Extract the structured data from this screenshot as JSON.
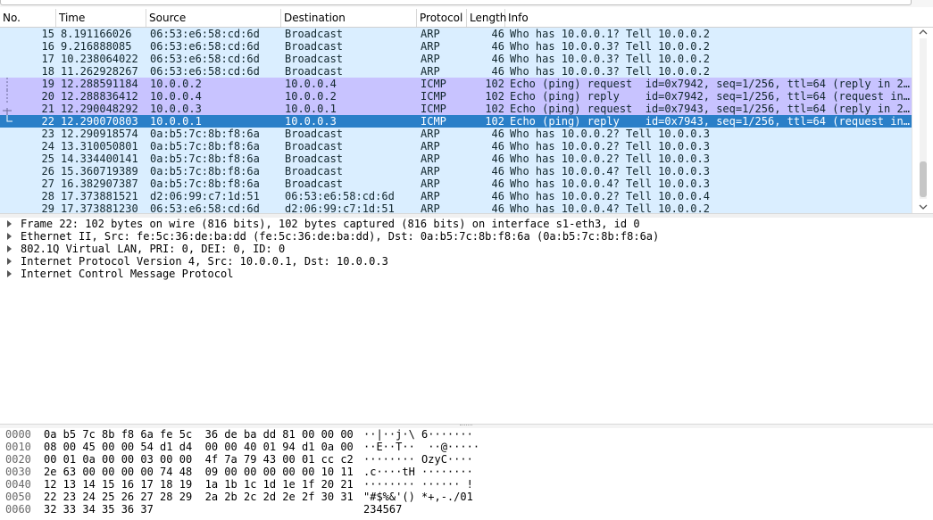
{
  "columns": {
    "no": "No.",
    "time": "Time",
    "source": "Source",
    "destination": "Destination",
    "protocol": "Protocol",
    "length": "Length",
    "info": "Info"
  },
  "packets": [
    {
      "no": "15",
      "time": "8.191166026",
      "src": "06:53:e6:58:cd:6d",
      "dst": "Broadcast",
      "proto": "ARP",
      "len": "46",
      "info": "Who has 10.0.0.1? Tell 10.0.0.2"
    },
    {
      "no": "16",
      "time": "9.216888085",
      "src": "06:53:e6:58:cd:6d",
      "dst": "Broadcast",
      "proto": "ARP",
      "len": "46",
      "info": "Who has 10.0.0.3? Tell 10.0.0.2"
    },
    {
      "no": "17",
      "time": "10.238064022",
      "src": "06:53:e6:58:cd:6d",
      "dst": "Broadcast",
      "proto": "ARP",
      "len": "46",
      "info": "Who has 10.0.0.3? Tell 10.0.0.2"
    },
    {
      "no": "18",
      "time": "11.262928267",
      "src": "06:53:e6:58:cd:6d",
      "dst": "Broadcast",
      "proto": "ARP",
      "len": "46",
      "info": "Who has 10.0.0.3? Tell 10.0.0.2"
    },
    {
      "no": "19",
      "time": "12.288591184",
      "src": "10.0.0.2",
      "dst": "10.0.0.4",
      "proto": "ICMP",
      "len": "102",
      "info": "Echo (ping) request  id=0x7942, seq=1/256, ttl=64 (reply in 2…"
    },
    {
      "no": "20",
      "time": "12.288836412",
      "src": "10.0.0.4",
      "dst": "10.0.0.2",
      "proto": "ICMP",
      "len": "102",
      "info": "Echo (ping) reply    id=0x7942, seq=1/256, ttl=64 (request in…"
    },
    {
      "no": "21",
      "time": "12.290048292",
      "src": "10.0.0.3",
      "dst": "10.0.0.1",
      "proto": "ICMP",
      "len": "102",
      "info": "Echo (ping) request  id=0x7943, seq=1/256, ttl=64 (reply in 2…"
    },
    {
      "no": "22",
      "time": "12.290070803",
      "src": "10.0.0.1",
      "dst": "10.0.0.3",
      "proto": "ICMP",
      "len": "102",
      "info": "Echo (ping) reply    id=0x7943, seq=1/256, ttl=64 (request in…"
    },
    {
      "no": "23",
      "time": "12.290918574",
      "src": "0a:b5:7c:8b:f8:6a",
      "dst": "Broadcast",
      "proto": "ARP",
      "len": "46",
      "info": "Who has 10.0.0.2? Tell 10.0.0.3"
    },
    {
      "no": "24",
      "time": "13.310050801",
      "src": "0a:b5:7c:8b:f8:6a",
      "dst": "Broadcast",
      "proto": "ARP",
      "len": "46",
      "info": "Who has 10.0.0.2? Tell 10.0.0.3"
    },
    {
      "no": "25",
      "time": "14.334400141",
      "src": "0a:b5:7c:8b:f8:6a",
      "dst": "Broadcast",
      "proto": "ARP",
      "len": "46",
      "info": "Who has 10.0.0.2? Tell 10.0.0.3"
    },
    {
      "no": "26",
      "time": "15.360719389",
      "src": "0a:b5:7c:8b:f8:6a",
      "dst": "Broadcast",
      "proto": "ARP",
      "len": "46",
      "info": "Who has 10.0.0.4? Tell 10.0.0.3"
    },
    {
      "no": "27",
      "time": "16.382907387",
      "src": "0a:b5:7c:8b:f8:6a",
      "dst": "Broadcast",
      "proto": "ARP",
      "len": "46",
      "info": "Who has 10.0.0.4? Tell 10.0.0.3"
    },
    {
      "no": "28",
      "time": "17.373881521",
      "src": "d2:06:99:c7:1d:51",
      "dst": "06:53:e6:58:cd:6d",
      "proto": "ARP",
      "len": "46",
      "info": "Who has 10.0.0.2? Tell 10.0.0.4"
    },
    {
      "no": "29",
      "time": "17.373881230",
      "src": "06:53:e6:58:cd:6d",
      "dst": "d2:06:99:c7:1d:51",
      "proto": "ARP",
      "len": "46",
      "info": "Who has 10.0.0.4? Tell 10.0.0.2"
    }
  ],
  "selected_packet": "22",
  "details": [
    "Frame 22: 102 bytes on wire (816 bits), 102 bytes captured (816 bits) on interface s1-eth3, id 0",
    "Ethernet II, Src: fe:5c:36:de:ba:dd (fe:5c:36:de:ba:dd), Dst: 0a:b5:7c:8b:f8:6a (0a:b5:7c:8b:f8:6a)",
    "802.1Q Virtual LAN, PRI: 0, DEI: 0, ID: 0",
    "Internet Protocol Version 4, Src: 10.0.0.1, Dst: 10.0.0.3",
    "Internet Control Message Protocol"
  ],
  "bytes": [
    {
      "offset": "0000",
      "hex": "0a b5 7c 8b f8 6a fe 5c  36 de ba dd 81 00 00 00",
      "ascii": "··|··j·\\ 6·······"
    },
    {
      "offset": "0010",
      "hex": "08 00 45 00 00 54 d1 d4  00 00 40 01 94 d1 0a 00",
      "ascii": "··E··T··  ··@·····"
    },
    {
      "offset": "0020",
      "hex": "00 01 0a 00 00 03 00 00  4f 7a 79 43 00 01 cc c2",
      "ascii": "········ OzyC····"
    },
    {
      "offset": "0030",
      "hex": "2e 63 00 00 00 00 74 48  09 00 00 00 00 00 10 11",
      "ascii": ".c····tH ········"
    },
    {
      "offset": "0040",
      "hex": "12 13 14 15 16 17 18 19  1a 1b 1c 1d 1e 1f 20 21",
      "ascii": "········ ······ !"
    },
    {
      "offset": "0050",
      "hex": "22 23 24 25 26 27 28 29  2a 2b 2c 2d 2e 2f 30 31",
      "ascii": "\"#$%&'() *+,-./01"
    },
    {
      "offset": "0060",
      "hex": "32 33 34 35 36 37",
      "ascii": "234567"
    }
  ],
  "colors": {
    "arp_row": "#daeeff",
    "icmp_row": "#c8c3ff",
    "selected_row": "#2a7fc8"
  }
}
